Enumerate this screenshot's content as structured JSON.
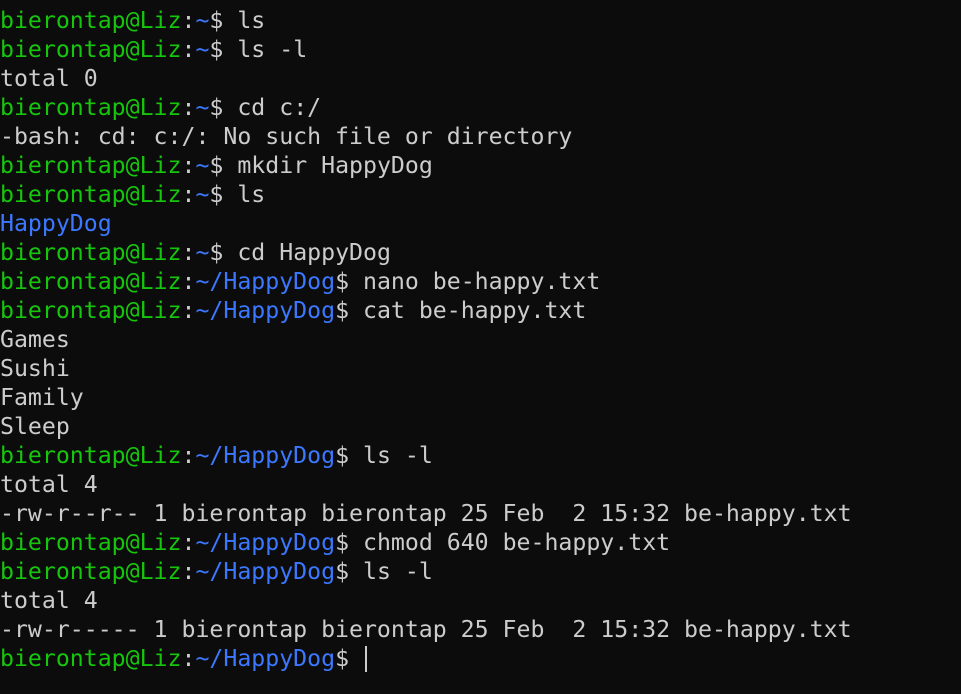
{
  "colors": {
    "background": "#0c0c0c",
    "prompt_user": "#16c60c",
    "prompt_path": "#3b78ff",
    "directory": "#3b78ff",
    "text": "#cccccc"
  },
  "prompt": {
    "user_host": "bierontap@Liz",
    "sep": ":"
  },
  "lines": [
    {
      "type": "prompt",
      "path": "~",
      "dollar": "$",
      "cmd": " ls"
    },
    {
      "type": "prompt",
      "path": "~",
      "dollar": "$",
      "cmd": " ls -l"
    },
    {
      "type": "output",
      "text": "total 0"
    },
    {
      "type": "prompt",
      "path": "~",
      "dollar": "$",
      "cmd": " cd c:/"
    },
    {
      "type": "output",
      "text": "-bash: cd: c:/: No such file or directory"
    },
    {
      "type": "prompt",
      "path": "~",
      "dollar": "$",
      "cmd": " mkdir HappyDog"
    },
    {
      "type": "prompt",
      "path": "~",
      "dollar": "$",
      "cmd": " ls"
    },
    {
      "type": "dir",
      "text": "HappyDog"
    },
    {
      "type": "prompt",
      "path": "~",
      "dollar": "$",
      "cmd": " cd HappyDog"
    },
    {
      "type": "prompt",
      "path": "~/HappyDog",
      "dollar": "$",
      "cmd": " nano be-happy.txt"
    },
    {
      "type": "prompt",
      "path": "~/HappyDog",
      "dollar": "$",
      "cmd": " cat be-happy.txt"
    },
    {
      "type": "output",
      "text": "Games"
    },
    {
      "type": "output",
      "text": "Sushi"
    },
    {
      "type": "output",
      "text": "Family"
    },
    {
      "type": "output",
      "text": "Sleep"
    },
    {
      "type": "prompt",
      "path": "~/HappyDog",
      "dollar": "$",
      "cmd": " ls -l"
    },
    {
      "type": "output",
      "text": "total 4"
    },
    {
      "type": "output",
      "text": "-rw-r--r-- 1 bierontap bierontap 25 Feb  2 15:32 be-happy.txt"
    },
    {
      "type": "prompt",
      "path": "~/HappyDog",
      "dollar": "$",
      "cmd": " chmod 640 be-happy.txt"
    },
    {
      "type": "prompt",
      "path": "~/HappyDog",
      "dollar": "$",
      "cmd": " ls -l"
    },
    {
      "type": "output",
      "text": "total 4"
    },
    {
      "type": "output",
      "text": "-rw-r----- 1 bierontap bierontap 25 Feb  2 15:32 be-happy.txt"
    },
    {
      "type": "prompt",
      "path": "~/HappyDog",
      "dollar": "$",
      "cmd": " ",
      "active": true
    }
  ]
}
